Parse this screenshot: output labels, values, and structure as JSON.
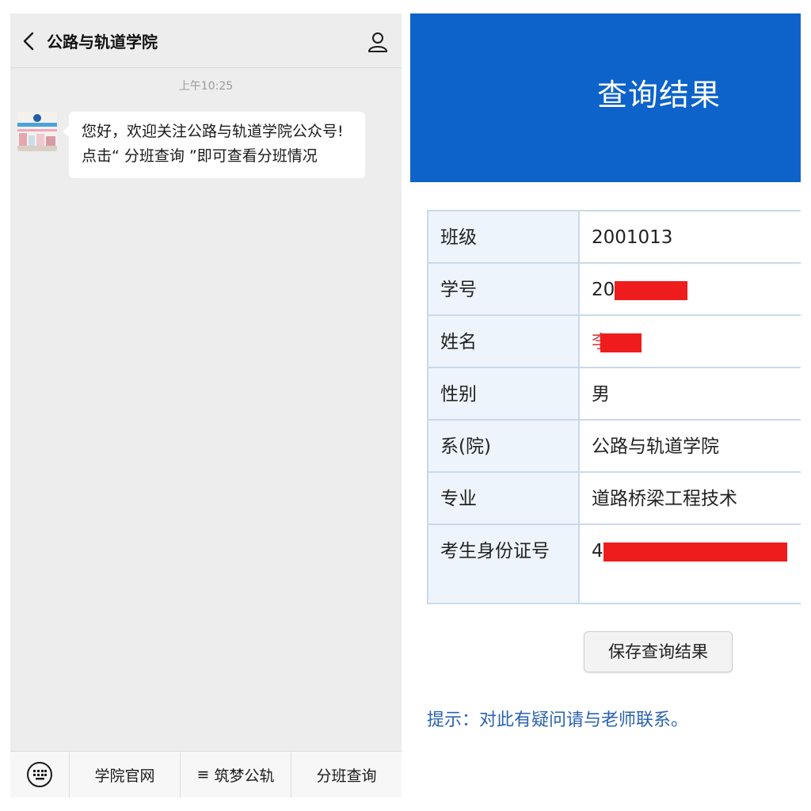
{
  "chat": {
    "title": "公路与轨道学院",
    "timestamp": "上午10:25",
    "avatar_label": "公路与轨道学院",
    "message_lines": [
      "您好，欢迎关注公路与轨道学院公众号!",
      "点击“ 分班查询 ”即可查看分班情况"
    ],
    "menu": [
      {
        "label": "学院官网",
        "prefix": ""
      },
      {
        "label": "筑梦公轨",
        "prefix": "≡"
      },
      {
        "label": "分班查询",
        "prefix": ""
      }
    ]
  },
  "result": {
    "title": "查询结果",
    "rows": [
      {
        "key": "班级",
        "value": "2001013"
      },
      {
        "key": "学号",
        "value": "20"
      },
      {
        "key": "姓名",
        "value": "李"
      },
      {
        "key": "性别",
        "value": "男"
      },
      {
        "key": "系(院)",
        "value": "公路与轨道学院"
      },
      {
        "key": "专业",
        "value": "道路桥梁工程技术"
      },
      {
        "key": "考生身份证号",
        "value": "4"
      }
    ],
    "save_button": "保存查询结果",
    "tip": "提示：对此有疑问请与老师联系。"
  },
  "colors": {
    "header_blue": "#0d63c9",
    "redaction": "#ee1c1c",
    "tip_text": "#2a63b2"
  },
  "icons": {
    "back": "chevron-left-icon",
    "profile": "person-icon",
    "keyboard": "keyboard-icon"
  }
}
